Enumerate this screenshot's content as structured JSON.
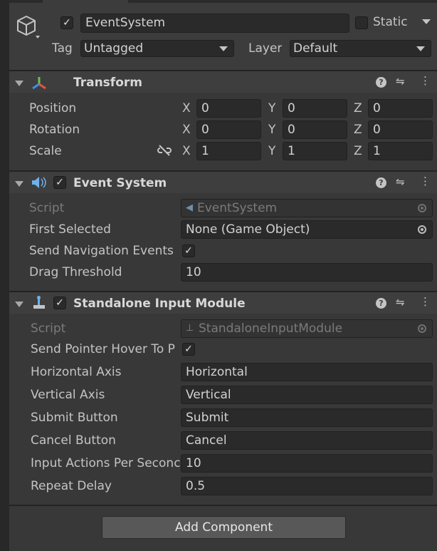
{
  "header": {
    "active": true,
    "object_name": "EventSystem",
    "static_label": "Static",
    "tag_label": "Tag",
    "tag_value": "Untagged",
    "layer_label": "Layer",
    "layer_value": "Default"
  },
  "transform": {
    "title": "Transform",
    "rows": [
      {
        "label": "Position",
        "x": "0",
        "y": "0",
        "z": "0"
      },
      {
        "label": "Rotation",
        "x": "0",
        "y": "0",
        "z": "0"
      },
      {
        "label": "Scale",
        "x": "1",
        "y": "1",
        "z": "1"
      }
    ],
    "axis_x": "X",
    "axis_y": "Y",
    "axis_z": "Z"
  },
  "event_system": {
    "title": "Event System",
    "enabled": true,
    "script_label": "Script",
    "script_value": "EventSystem",
    "first_selected_label": "First Selected",
    "first_selected_value": "None (Game Object)",
    "send_nav_label": "Send Navigation Events",
    "send_nav_checked": true,
    "drag_threshold_label": "Drag Threshold",
    "drag_threshold_value": "10"
  },
  "standalone": {
    "title": "Standalone Input Module",
    "enabled": true,
    "script_label": "Script",
    "script_value": "StandaloneInputModule",
    "hover_label": "Send Pointer Hover To P",
    "hover_checked": true,
    "fields": [
      {
        "label": "Horizontal Axis",
        "value": "Horizontal"
      },
      {
        "label": "Vertical Axis",
        "value": "Vertical"
      },
      {
        "label": "Submit Button",
        "value": "Submit"
      },
      {
        "label": "Cancel Button",
        "value": "Cancel"
      },
      {
        "label": "Input Actions Per Seconc",
        "value": "10"
      },
      {
        "label": "Repeat Delay",
        "value": "0.5"
      }
    ]
  },
  "add_component_label": "Add Component",
  "check_mark": "✓",
  "colors": {
    "background": "#383838",
    "field": "#2a2a2a",
    "text": "#c4c4c4"
  }
}
